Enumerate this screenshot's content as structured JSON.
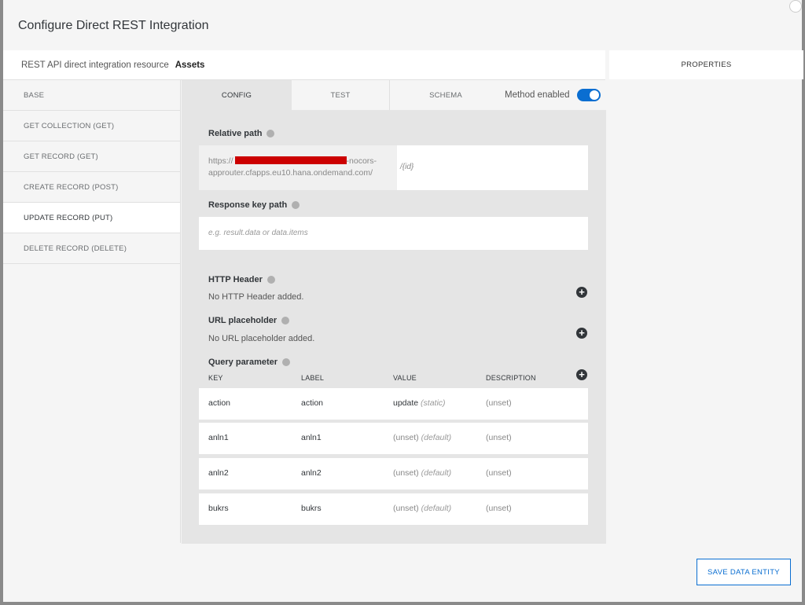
{
  "modal": {
    "title": "Configure Direct REST Integration"
  },
  "resource": {
    "label": "REST API direct integration resource",
    "value": "Assets"
  },
  "properties": {
    "header": "PROPERTIES"
  },
  "sidebar": {
    "items": [
      {
        "label": "BASE"
      },
      {
        "label": "GET COLLECTION (GET)"
      },
      {
        "label": "GET RECORD (GET)"
      },
      {
        "label": "CREATE RECORD (POST)"
      },
      {
        "label": "UPDATE RECORD (PUT)"
      },
      {
        "label": "DELETE RECORD (DELETE)"
      }
    ]
  },
  "tabs": [
    {
      "label": "CONFIG"
    },
    {
      "label": "TEST"
    },
    {
      "label": "SCHEMA"
    }
  ],
  "method_enabled": {
    "label": "Method enabled",
    "on": true
  },
  "relative_path": {
    "label": "Relative path",
    "base_prefix": "https://",
    "base_suffix": "-nocors-approuter.cfapps.eu10.hana.ondemand.com/",
    "suffix": "/{id}"
  },
  "response_key": {
    "label": "Response key path",
    "placeholder": "e.g. result.data or data.items"
  },
  "http_header": {
    "label": "HTTP Header",
    "empty": "No HTTP Header added."
  },
  "url_placeholder": {
    "label": "URL placeholder",
    "empty": "No URL placeholder added."
  },
  "query_param": {
    "label": "Query parameter",
    "columns": [
      "KEY",
      "LABEL",
      "VALUE",
      "DESCRIPTION"
    ],
    "rows": [
      {
        "key": "action",
        "label": "action",
        "value": "update",
        "value_note": "(static)",
        "description": "(unset)"
      },
      {
        "key": "anln1",
        "label": "anln1",
        "value": "(unset)",
        "value_note": "(default)",
        "description": "(unset)"
      },
      {
        "key": "anln2",
        "label": "anln2",
        "value": "(unset)",
        "value_note": "(default)",
        "description": "(unset)"
      },
      {
        "key": "bukrs",
        "label": "bukrs",
        "value": "(unset)",
        "value_note": "(default)",
        "description": "(unset)"
      }
    ]
  },
  "footer": {
    "save_label": "SAVE DATA ENTITY"
  },
  "colors": {
    "accent": "#0a6ed1",
    "redaction": "#cc0000"
  },
  "icons": {
    "info": "info-icon",
    "add": "plus-circle-icon",
    "close": "close-icon"
  }
}
